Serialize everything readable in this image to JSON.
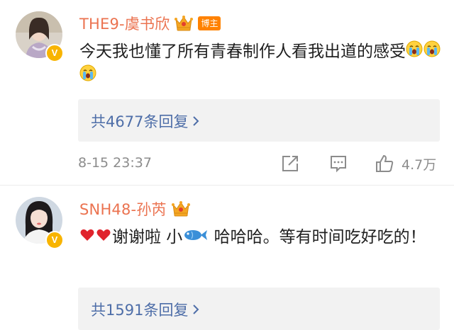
{
  "comments": [
    {
      "username": "THE9-虞书欣",
      "owner_tag": "博主",
      "text": "今天我也懂了所有青春制作人看我出道的感受",
      "emoji": [
        "crying-face",
        "crying-face",
        "crying-face"
      ],
      "replies_label": "共4677条回复",
      "timestamp": "8-15 23:37",
      "like_count": "4.7万",
      "verified_badge": "V"
    },
    {
      "username": "SNH48-孙芮",
      "text_part1": "谢谢啦 小",
      "text_part2": " 哈哈哈。等有时间吃好吃的！",
      "replies_label": "共1591条回复",
      "verified_badge": "V"
    }
  ],
  "colors": {
    "username": "#eb7350",
    "link": "#4e6ea8",
    "owner_tag_bg": "#ff8200",
    "verified": "#f8b400",
    "meta_gray": "#8c8c8c",
    "reply_bg": "#f2f2f2"
  },
  "icons": [
    "crown-icon",
    "share-icon",
    "comment-icon",
    "like-icon",
    "chevron-right-icon",
    "heart-icon",
    "fish-icon",
    "crying-face-icon"
  ]
}
